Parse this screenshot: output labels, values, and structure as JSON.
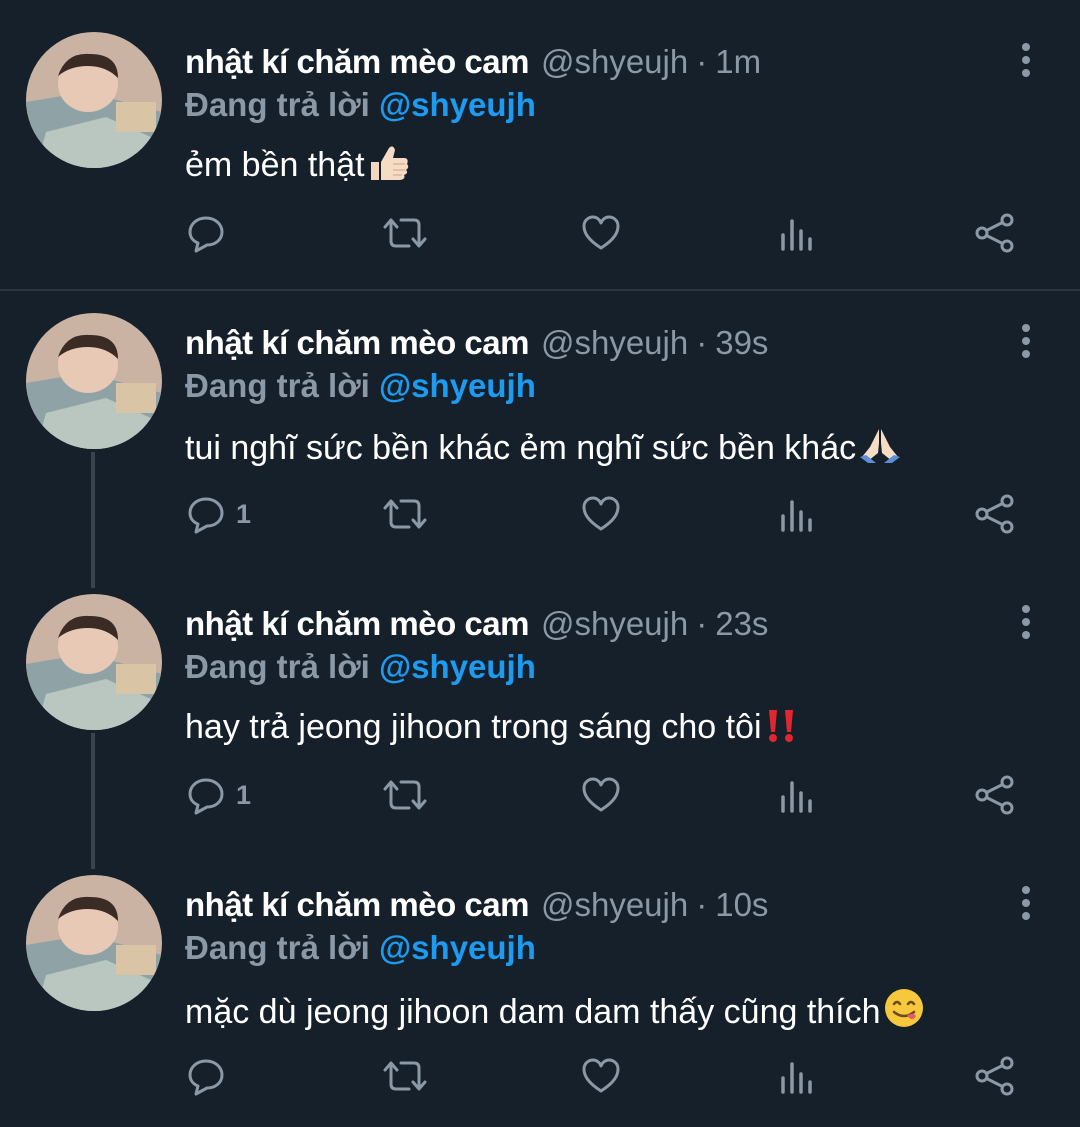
{
  "tweets": [
    {
      "name": "nhật kí chăm mèo cam",
      "handle": "@shyeujh",
      "separator": "·",
      "time": "1m",
      "replying_label": "Đang trả lời",
      "replying_to": "@shyeujh",
      "text": "ẻm bền thật",
      "emoji": "thumbs-up-emoji",
      "reply_count": ""
    },
    {
      "name": "nhật kí chăm mèo cam",
      "handle": "@shyeujh",
      "separator": "·",
      "time": "39s",
      "replying_label": "Đang trả lời",
      "replying_to": "@shyeujh",
      "text": "tui nghĩ sức bền khác ẻm nghĩ sức bền khác",
      "emoji": "folded-hands-emoji",
      "reply_count": "1"
    },
    {
      "name": "nhật kí chăm mèo cam",
      "handle": "@shyeujh",
      "separator": "·",
      "time": "23s",
      "replying_label": "Đang trả lời",
      "replying_to": "@shyeujh",
      "text": "hay trả jeong jihoon trong sáng cho tôi",
      "emoji": "double-exclamation-emoji",
      "reply_count": "1"
    },
    {
      "name": "nhật kí chăm mèo cam",
      "handle": "@shyeujh",
      "separator": "·",
      "time": "10s",
      "replying_label": "Đang trả lời",
      "replying_to": "@shyeujh",
      "text": "mặc dù jeong jihoon dam dam thấy cũng thích",
      "emoji": "yum-face-emoji",
      "reply_count": ""
    }
  ],
  "colors": {
    "background": "#15202b",
    "mention": "#1d9bf0",
    "muted": "#8b98a5",
    "thread_line": "#38444d"
  },
  "icons": [
    "reply-icon",
    "retweet-icon",
    "like-icon",
    "views-icon",
    "share-icon",
    "more-icon"
  ]
}
